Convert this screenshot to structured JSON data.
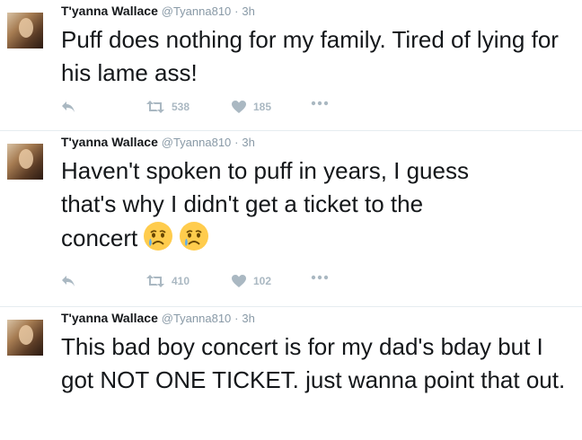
{
  "tweets": [
    {
      "name": "T'yanna Wallace",
      "handle": "@Tyanna810",
      "separator": "·",
      "time": "3h",
      "text": "Puff does nothing for my family. Tired of lying for his lame ass!",
      "retweets": "538",
      "likes": "185"
    },
    {
      "name": "T'yanna Wallace",
      "handle": "@Tyanna810",
      "separator": "·",
      "time": "3h",
      "text_line1": "Haven't spoken to puff in years, I guess",
      "text_line2": "that's why I didn't get a ticket to the",
      "text_line3": "concert",
      "emojis": [
        "crying-face",
        "crying-face"
      ],
      "retweets": "410",
      "likes": "102"
    },
    {
      "name": "T'yanna Wallace",
      "handle": "@Tyanna810",
      "separator": "·",
      "time": "3h",
      "text": "This bad boy concert is for my dad's bday but I got NOT ONE TICKET. just wanna point that out."
    }
  ],
  "icons": {
    "reply": "reply-icon",
    "retweet": "retweet-icon",
    "like": "heart-icon",
    "more": "more-dots-icon"
  },
  "colors": {
    "text": "#14171a",
    "muted": "#8899a6",
    "action": "#aab8c2",
    "divider": "#e6ecf0"
  }
}
